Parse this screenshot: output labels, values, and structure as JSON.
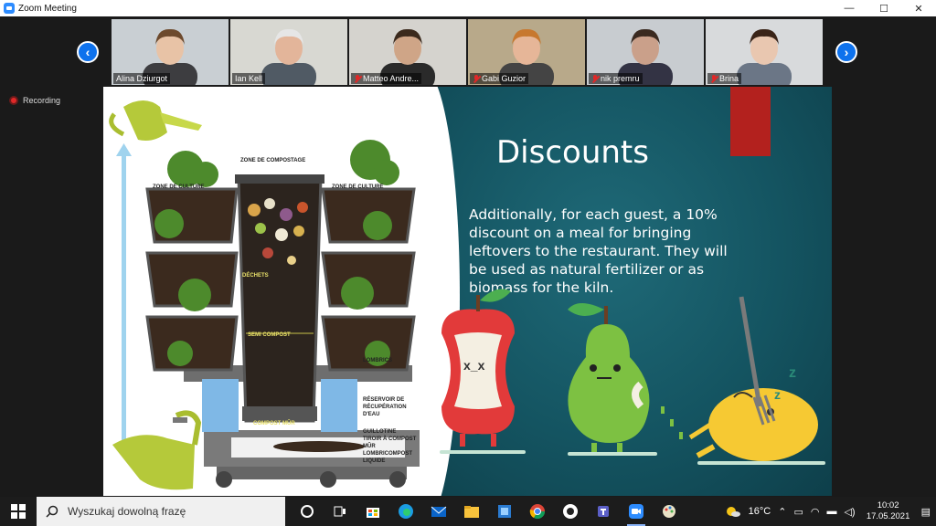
{
  "window": {
    "title": "Zoom Meeting",
    "minimize": "—",
    "maximize": "☐",
    "close": "✕"
  },
  "participants": [
    {
      "name": "Alina Dziurgot",
      "muted": false,
      "bg": "#c9cfd3",
      "face": "#e8c3a6",
      "hair": "#6d4a2d",
      "shirt": "#3d3d40"
    },
    {
      "name": "Ian Kell",
      "muted": false,
      "bg": "#d8d8d2",
      "face": "#e3b59a",
      "hair": "#e6e6e6",
      "shirt": "#505a64"
    },
    {
      "name": "Matteo Andre...",
      "muted": true,
      "bg": "#d5d3ce",
      "face": "#cfa587",
      "hair": "#3b2a1d",
      "shirt": "#2a2a2a"
    },
    {
      "name": "Gabi Guzior",
      "muted": true,
      "bg": "#b8a98a",
      "face": "#e6b698",
      "hair": "#c7782f",
      "shirt": "#444"
    },
    {
      "name": "nik premru",
      "muted": true,
      "bg": "#c8ccd0",
      "face": "#caa08a",
      "hair": "#3a2a20",
      "shirt": "#334"
    },
    {
      "name": "Brina",
      "muted": true,
      "bg": "#d8dadc",
      "face": "#e9c7b0",
      "hair": "#3a2418",
      "shirt": "#6b7686"
    }
  ],
  "nav": {
    "prev": "‹",
    "next": "›"
  },
  "recording": {
    "label": "Recording"
  },
  "slide": {
    "title": "Discounts",
    "body": "Additionally, for each guest, a 10% discount on a meal for bringing leftovers to the restaurant. They will be used as natural fertilizer or as biomass for the kiln.",
    "diagram_labels": {
      "zone_compostage": "ZONE DE COMPOSTAGE",
      "zone_culture_left": "ZONE DE CULTURE",
      "zone_culture_right": "ZONE DE CULTURE",
      "dechets": "DÉCHETS",
      "semi_compost": "SEMI COMPOST",
      "lombrics": "LOMBRICS",
      "reservoir_1": "RÉSERVOIR DE",
      "reservoir_2": "RÉCUPÉRATION",
      "reservoir_3": "D'EAU",
      "compost_mur": "COMPOST MÛR",
      "guillotine": "GUILLOTINE",
      "tiroir_1": "TIROIR À COMPOST",
      "tiroir_2": "MÛR",
      "lombricompost_1": "LOMBRICOMPOST",
      "lombricompost_2": "LIQUIDE"
    },
    "sleep_z": "z"
  },
  "taskbar": {
    "search_placeholder": "Wyszukaj dowolną frazę",
    "weather": "16°C",
    "time": "10:02",
    "date": "17.05.2021"
  }
}
